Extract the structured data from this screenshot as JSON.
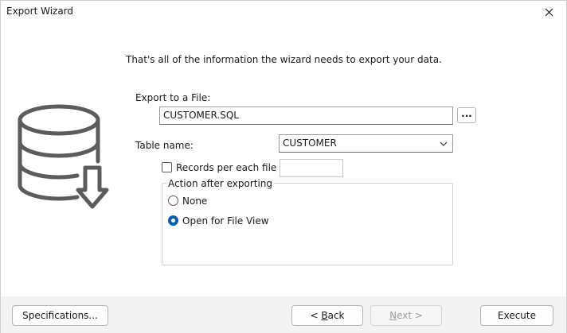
{
  "window": {
    "title": "Export Wizard"
  },
  "intro_text": "That's all of the information the wizard needs to export your data.",
  "export_file": {
    "label": "Export to a File:",
    "value": "CUSTOMER.SQL",
    "browse_label": "..."
  },
  "table": {
    "label": "Table name:",
    "value": "CUSTOMER"
  },
  "records_per_file": {
    "label": "Records per each file",
    "checked": false,
    "value": ""
  },
  "action_group": {
    "legend": "Action after exporting",
    "options": [
      {
        "label": "None",
        "checked": false
      },
      {
        "label": "Open for File View",
        "checked": true
      }
    ]
  },
  "footer": {
    "specifications_label": "Specifications...",
    "back_label_prefix": "< ",
    "back_label_access": "B",
    "back_label_rest": "ack",
    "next_label_access": "N",
    "next_label_rest": "ext >",
    "execute_label": "Execute"
  },
  "colors": {
    "accent": "#005fb8",
    "footer_bg": "#f3f3f3"
  }
}
